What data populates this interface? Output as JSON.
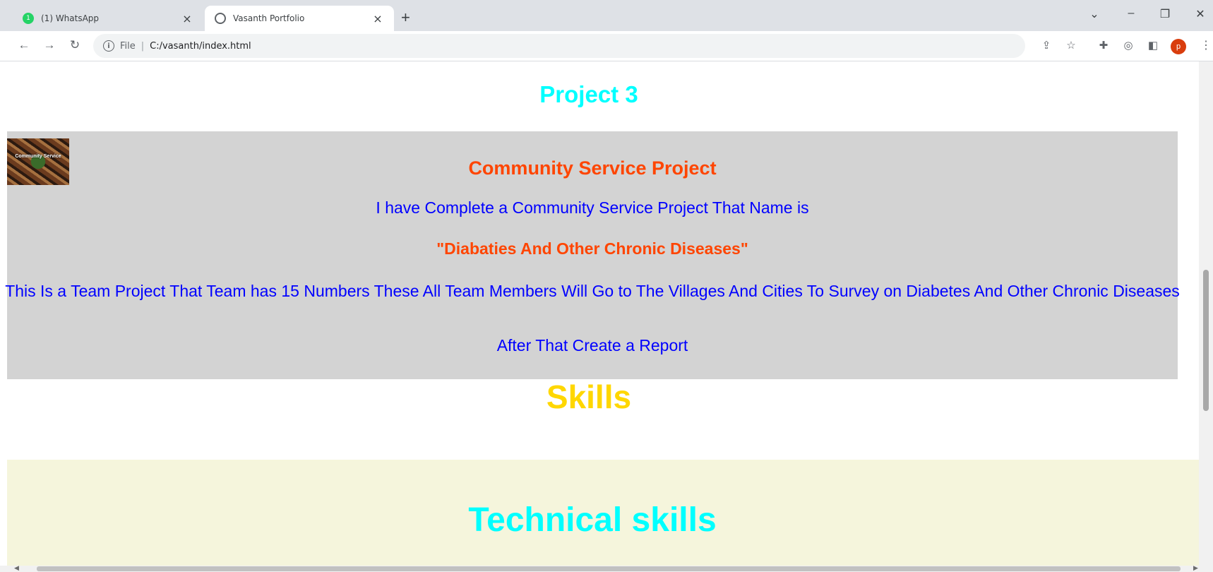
{
  "browser": {
    "tabs": [
      {
        "title": "(1) WhatsApp",
        "active": false,
        "favicon": "whatsapp-icon",
        "badge": "1"
      },
      {
        "title": "Vasanth Portfolio",
        "active": true,
        "favicon": "globe-icon"
      }
    ],
    "address": {
      "scheme_label": "File",
      "path": "C:/vasanth/index.html"
    },
    "profile_initial": "p"
  },
  "page": {
    "project_heading": "Project 3",
    "project": {
      "thumbnail_caption": "Community Service",
      "title": "Community Service Project",
      "line1": "I have Complete a Community Service Project That Name is",
      "quote": "\"Diabaties And Other Chronic Diseases\"",
      "line2": "This Is a Team Project That Team has 15 Numbers These All Team Members Will Go to The Villages And Cities To Survey on Diabetes And Other Chronic Diseases",
      "line3": "After That Create a Report"
    },
    "skills_heading": "Skills",
    "technical_heading": "Technical skills"
  },
  "colors": {
    "cyan_heading": "#00ffff",
    "orange_title": "#ff4500",
    "blue_text": "#0000ff",
    "gold_heading": "#ffd700",
    "project_bg": "#d3d3d3",
    "tech_bg": "#f5f5dc"
  }
}
